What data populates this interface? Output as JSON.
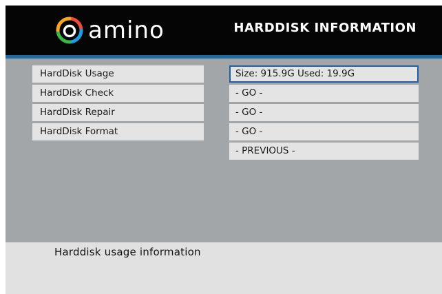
{
  "header": {
    "logo_text": "amino",
    "title": "HARDDISK INFORMATION"
  },
  "menu": {
    "items": [
      {
        "label": "HardDisk Usage",
        "value": "Size: 915.9G Used: 19.9G"
      },
      {
        "label": "HardDisk Check",
        "value": "- GO -"
      },
      {
        "label": "HardDisk Repair",
        "value": "- GO -"
      },
      {
        "label": "HardDisk Format",
        "value": "- GO -"
      }
    ],
    "previous_label": "- PREVIOUS -"
  },
  "footer": {
    "help_text": "Harddisk usage information"
  },
  "colors": {
    "header_background": "#050505",
    "accent_line": "#1f6aa0",
    "content_background": "#a3a6a8",
    "row_background": "#e4e4e4",
    "selection_border": "#1f5fa8",
    "footer_background": "#e1e1e1"
  },
  "icons": {
    "logo": "amino-swirl-logo-icon"
  }
}
